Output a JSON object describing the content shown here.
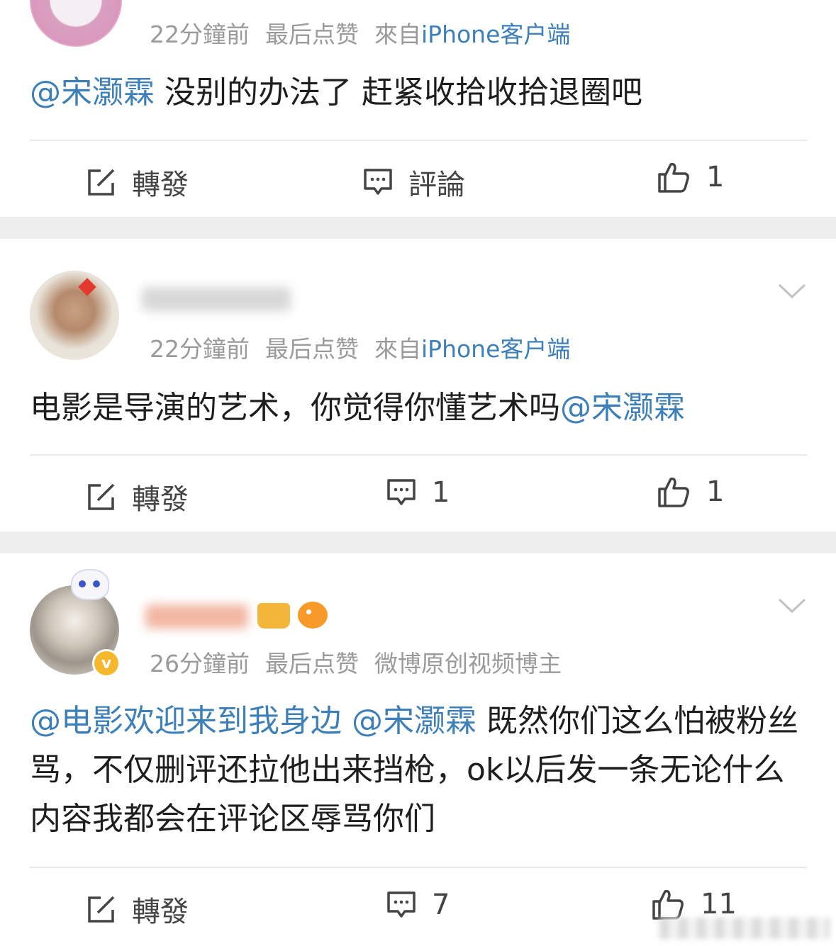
{
  "posts": [
    {
      "time": "22分鐘前",
      "last_like": "最后点赞",
      "source": "來自",
      "source_link": "iPhone客户端",
      "mention1": "@宋灏霖",
      "text": " 没别的办法了 赶紧收拾收拾退圈吧",
      "repost_label": "轉發",
      "comment_label": "評論",
      "like_count": "1"
    },
    {
      "time": "22分鐘前",
      "last_like": "最后点赞",
      "source": "來自",
      "source_link": "iPhone客户端",
      "text": "电影是导演的艺术，你觉得你懂艺术吗",
      "mention1": "@宋灏霖",
      "repost_label": "轉發",
      "comment_count": "1",
      "like_count": "1"
    },
    {
      "time": "26分鐘前",
      "last_like": "最后点赞",
      "tag": "微博原创视频博主",
      "mention1": "@电影欢迎来到我身边",
      "mention2": "@宋灏霖",
      "text": " 既然你们这么怕被粉丝骂，不仅删评还拉他出来挡枪，ok以后发一条无论什么内容我都会在评论区辱骂你们",
      "repost_label": "轉發",
      "comment_count": "7",
      "like_count": "11"
    }
  ],
  "colors": {
    "link": "#3d7fb8",
    "meta": "#9a9a9a",
    "gap": "#eeeeee"
  }
}
